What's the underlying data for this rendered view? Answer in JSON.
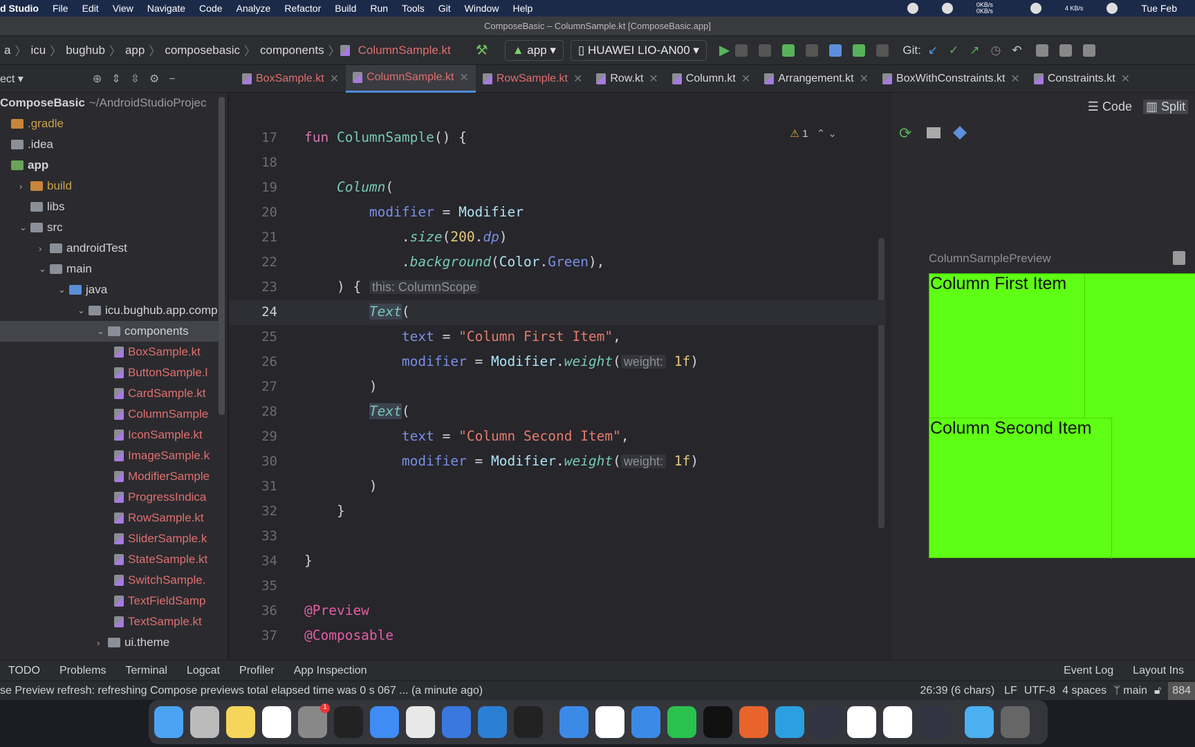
{
  "menubar": {
    "app": "d Studio",
    "items": [
      "File",
      "Edit",
      "View",
      "Navigate",
      "Code",
      "Analyze",
      "Refactor",
      "Build",
      "Run",
      "Tools",
      "Git",
      "Window",
      "Help"
    ],
    "net_up": "0KB/s",
    "net_down": "0KB/s",
    "net2": "4 KB/s",
    "clock": "Tue Feb"
  },
  "window_title": "ComposeBasic – ColumnSample.kt [ComposeBasic.app]",
  "breadcrumb": [
    "a",
    "icu",
    "bughub",
    "app",
    "composebasic",
    "components",
    "ColumnSample.kt"
  ],
  "toolbar": {
    "run_config": "app",
    "device": "HUAWEI LIO-AN00",
    "git_label": "Git:"
  },
  "project_header": "ect",
  "tabs": [
    {
      "label": "BoxSample.kt",
      "modified": true
    },
    {
      "label": "ColumnSample.kt",
      "modified": true,
      "active": true
    },
    {
      "label": "RowSample.kt",
      "modified": true
    },
    {
      "label": "Row.kt"
    },
    {
      "label": "Column.kt"
    },
    {
      "label": "Arrangement.kt"
    },
    {
      "label": "BoxWithConstraints.kt"
    },
    {
      "label": "Constraints.kt"
    }
  ],
  "tree": [
    {
      "label": "ComposeBasic",
      "extra": "~/AndroidStudioProjec",
      "depth": 0,
      "type": "root"
    },
    {
      "label": ".gradle",
      "depth": 0,
      "type": "folder-orange",
      "color": "#c9a14a"
    },
    {
      "label": ".idea",
      "depth": 0,
      "type": "folder"
    },
    {
      "label": "app",
      "depth": 0,
      "type": "module",
      "bold": true
    },
    {
      "label": "build",
      "depth": 1,
      "type": "folder-orange",
      "arrow": "›",
      "color": "#c9a14a"
    },
    {
      "label": "libs",
      "depth": 1,
      "type": "folder"
    },
    {
      "label": "src",
      "depth": 1,
      "type": "folder",
      "arrow": "⌄"
    },
    {
      "label": "androidTest",
      "depth": 2,
      "type": "folder",
      "arrow": "›"
    },
    {
      "label": "main",
      "depth": 2,
      "type": "folder",
      "arrow": "⌄"
    },
    {
      "label": "java",
      "depth": 3,
      "type": "folder-blue",
      "arrow": "⌄"
    },
    {
      "label": "icu.bughub.app.comp",
      "depth": 4,
      "type": "folder",
      "arrow": "⌄"
    },
    {
      "label": "components",
      "depth": 5,
      "type": "folder",
      "arrow": "⌄",
      "selected": true
    },
    {
      "label": "BoxSample.kt",
      "depth": 6,
      "type": "kt"
    },
    {
      "label": "ButtonSample.l",
      "depth": 6,
      "type": "kt"
    },
    {
      "label": "CardSample.kt",
      "depth": 6,
      "type": "kt"
    },
    {
      "label": "ColumnSample",
      "depth": 6,
      "type": "kt"
    },
    {
      "label": "IconSample.kt",
      "depth": 6,
      "type": "kt"
    },
    {
      "label": "ImageSample.k",
      "depth": 6,
      "type": "kt"
    },
    {
      "label": "ModifierSample",
      "depth": 6,
      "type": "kt"
    },
    {
      "label": "ProgressIndica",
      "depth": 6,
      "type": "kt"
    },
    {
      "label": "RowSample.kt",
      "depth": 6,
      "type": "kt"
    },
    {
      "label": "SliderSample.k",
      "depth": 6,
      "type": "kt"
    },
    {
      "label": "StateSample.kt",
      "depth": 6,
      "type": "kt"
    },
    {
      "label": "SwitchSample.",
      "depth": 6,
      "type": "kt"
    },
    {
      "label": "TextFieldSamp",
      "depth": 6,
      "type": "kt"
    },
    {
      "label": "TextSample.kt",
      "depth": 6,
      "type": "kt"
    },
    {
      "label": "ui.theme",
      "depth": 5,
      "type": "folder",
      "arrow": "›"
    }
  ],
  "editor": {
    "warning_count": "1",
    "current_line": 24,
    "lines": [
      {
        "n": "17",
        "t": [
          [
            "fun ",
            "kw"
          ],
          [
            "ColumnSample",
            "fn"
          ],
          [
            "() {",
            ""
          ]
        ]
      },
      {
        "n": "18",
        "t": []
      },
      {
        "n": "19",
        "t": [
          [
            "    ",
            ""
          ],
          [
            "Column",
            "fn it"
          ],
          [
            "(",
            ""
          ]
        ]
      },
      {
        "n": "20",
        "t": [
          [
            "        ",
            ""
          ],
          [
            "modifier",
            "prm"
          ],
          [
            " = ",
            ""
          ],
          [
            "Modifier",
            "cls"
          ]
        ]
      },
      {
        "n": "21",
        "t": [
          [
            "            .",
            ""
          ],
          [
            "size",
            "fn it"
          ],
          [
            "(",
            ""
          ],
          [
            "200",
            "num"
          ],
          [
            ".",
            ""
          ],
          [
            "dp",
            "prm it"
          ],
          [
            ")",
            ""
          ]
        ]
      },
      {
        "n": "22",
        "t": [
          [
            "            .",
            ""
          ],
          [
            "background",
            "fn it"
          ],
          [
            "(",
            ""
          ],
          [
            "Color",
            "cls"
          ],
          [
            ".",
            ""
          ],
          [
            "Green",
            "prm"
          ],
          [
            "),",
            ""
          ]
        ]
      },
      {
        "n": "23",
        "t": [
          [
            "    ) { ",
            ""
          ],
          [
            "this: ColumnScope",
            "hint"
          ]
        ]
      },
      {
        "n": "24",
        "t": [
          [
            "        ",
            ""
          ],
          [
            "Text",
            "fn it hl"
          ],
          [
            "(",
            ""
          ]
        ]
      },
      {
        "n": "25",
        "t": [
          [
            "            ",
            ""
          ],
          [
            "text",
            "prm"
          ],
          [
            " = ",
            ""
          ],
          [
            "\"Column First Item\"",
            "str"
          ],
          [
            ",",
            ""
          ]
        ]
      },
      {
        "n": "26",
        "t": [
          [
            "            ",
            ""
          ],
          [
            "modifier",
            "prm"
          ],
          [
            " = ",
            ""
          ],
          [
            "Modifier",
            "cls"
          ],
          [
            ".",
            ""
          ],
          [
            "weight",
            "fn it"
          ],
          [
            "(",
            ""
          ],
          [
            "weight:",
            "hint"
          ],
          [
            " ",
            ""
          ],
          [
            "1f",
            "num"
          ],
          [
            ")",
            ""
          ]
        ]
      },
      {
        "n": "27",
        "t": [
          [
            "        )",
            ""
          ]
        ]
      },
      {
        "n": "28",
        "t": [
          [
            "        ",
            ""
          ],
          [
            "Text",
            "fn it hl"
          ],
          [
            "(",
            ""
          ]
        ]
      },
      {
        "n": "29",
        "t": [
          [
            "            ",
            ""
          ],
          [
            "text",
            "prm"
          ],
          [
            " = ",
            ""
          ],
          [
            "\"Column Second Item\"",
            "str"
          ],
          [
            ",",
            ""
          ]
        ]
      },
      {
        "n": "30",
        "t": [
          [
            "            ",
            ""
          ],
          [
            "modifier",
            "prm"
          ],
          [
            " = ",
            ""
          ],
          [
            "Modifier",
            "cls"
          ],
          [
            ".",
            ""
          ],
          [
            "weight",
            "fn it"
          ],
          [
            "(",
            ""
          ],
          [
            "weight:",
            "hint"
          ],
          [
            " ",
            ""
          ],
          [
            "1f",
            "num"
          ],
          [
            ")",
            ""
          ]
        ]
      },
      {
        "n": "31",
        "t": [
          [
            "        )",
            ""
          ]
        ]
      },
      {
        "n": "32",
        "t": [
          [
            "    }",
            ""
          ]
        ]
      },
      {
        "n": "33",
        "t": []
      },
      {
        "n": "34",
        "t": [
          [
            "}",
            ""
          ]
        ]
      },
      {
        "n": "35",
        "t": []
      },
      {
        "n": "36",
        "t": [
          [
            "@Preview",
            "ann"
          ]
        ]
      },
      {
        "n": "37",
        "t": [
          [
            "@Composable",
            "ann"
          ]
        ]
      }
    ]
  },
  "preview": {
    "modes": [
      "Code",
      "Split"
    ],
    "title": "ColumnSamplePreview",
    "items": [
      "Column First Item",
      "Column Second Item"
    ],
    "bg_color": "#5eff14"
  },
  "tool_windows": [
    "TODO",
    "Problems",
    "Terminal",
    "Logcat",
    "Profiler",
    "App Inspection"
  ],
  "tool_windows_right": [
    "Event Log",
    "Layout Ins"
  ],
  "status": {
    "message": "se Preview refresh: refreshing Compose previews total elapsed time was 0 s 067 ... (a minute ago)",
    "position": "26:39 (6 chars)",
    "line_sep": "LF",
    "encoding": "UTF-8",
    "indent": "4 spaces",
    "branch": "main",
    "memory": "884"
  },
  "dock": {
    "badge": "1",
    "icons": [
      "finder-icon",
      "launchpad-icon",
      "notes-icon",
      "typora-icon",
      "system-preferences-icon",
      "terminal-icon",
      "feishu-icon",
      "chrome-icon",
      "xcode-icon",
      "vscode-icon",
      "activity-monitor-icon",
      "safari-icon",
      "kotlin-icon",
      "android-studio-icon",
      "wechat-icon",
      "iterm-icon",
      "postman-icon",
      "telegram-icon",
      "charles-icon",
      "wps-icon",
      "qq-icon",
      "quicktime-icon",
      "downloads-icon",
      "trash-icon"
    ],
    "colors": [
      "#4aa3f5",
      "#bbb",
      "#f5d55a",
      "#fff",
      "#888",
      "#222",
      "#3f8cf5",
      "#e8e8e8",
      "#3a78e0",
      "#2a7fd4",
      "#222",
      "#3c8ae8",
      "#fff",
      "#3c8ae8",
      "#2bc14f",
      "#111",
      "#e8642c",
      "#2aa0e0",
      "#334",
      "#fff",
      "#fff",
      "#334",
      "#4ab0f0",
      "#666"
    ]
  }
}
